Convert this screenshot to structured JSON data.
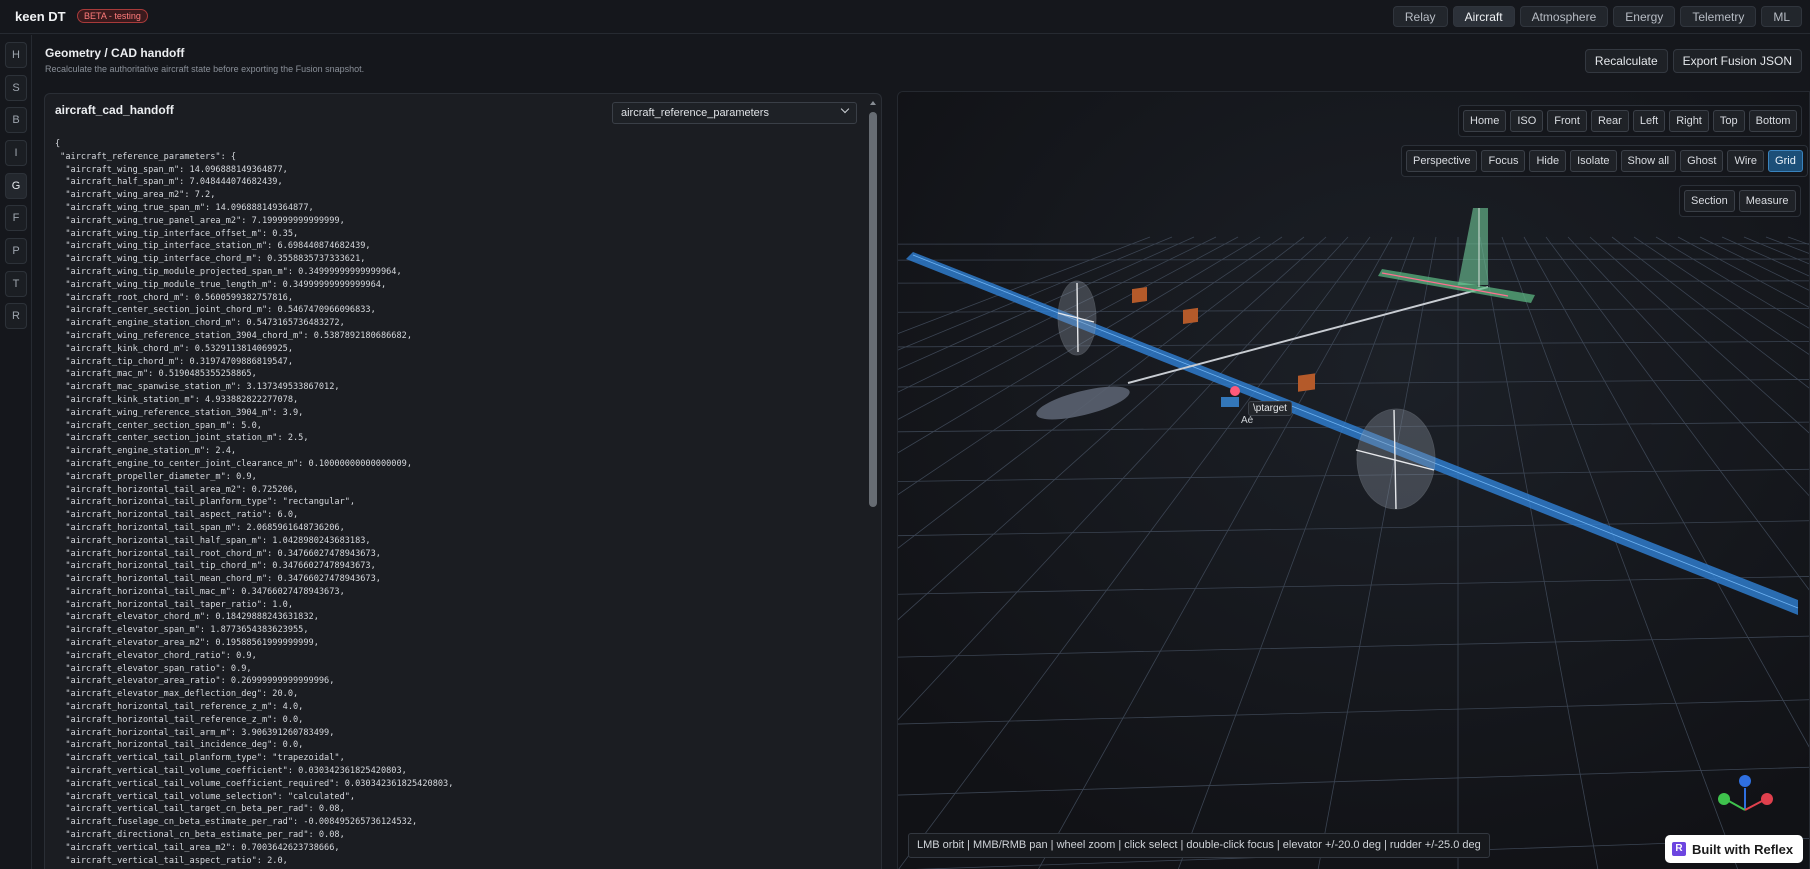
{
  "app": {
    "title": "keen DT",
    "badge": "BETA - testing"
  },
  "nav": [
    {
      "label": "Relay",
      "active": false
    },
    {
      "label": "Aircraft",
      "active": true
    },
    {
      "label": "Atmosphere",
      "active": false
    },
    {
      "label": "Energy",
      "active": false
    },
    {
      "label": "Telemetry",
      "active": false
    },
    {
      "label": "ML",
      "active": false
    }
  ],
  "rail": [
    "H",
    "S",
    "B",
    "I",
    "G",
    "F",
    "P",
    "T",
    "R"
  ],
  "rail_active": "G",
  "header": {
    "title": "Geometry / CAD handoff",
    "subtitle": "Recalculate the authoritative aircraft state before exporting the Fusion snapshot.",
    "recalculate_label": "Recalculate",
    "export_label": "Export Fusion JSON"
  },
  "json_panel": {
    "title": "aircraft_cad_handoff",
    "select_value": "aircraft_reference_parameters",
    "lines": [
      "{",
      " \"aircraft_reference_parameters\": {",
      "  \"aircraft_wing_span_m\": 14.096888149364877,",
      "  \"aircraft_half_span_m\": 7.048444074682439,",
      "  \"aircraft_wing_area_m2\": 7.2,",
      "  \"aircraft_wing_true_span_m\": 14.096888149364877,",
      "  \"aircraft_wing_true_panel_area_m2\": 7.199999999999999,",
      "  \"aircraft_wing_tip_interface_offset_m\": 0.35,",
      "  \"aircraft_wing_tip_interface_station_m\": 6.698440874682439,",
      "  \"aircraft_wing_tip_interface_chord_m\": 0.3558835737333621,",
      "  \"aircraft_wing_tip_module_projected_span_m\": 0.34999999999999964,",
      "  \"aircraft_wing_tip_module_true_length_m\": 0.34999999999999964,",
      "  \"aircraft_root_chord_m\": 0.5600599382757816,",
      "  \"aircraft_center_section_joint_chord_m\": 0.5467470966096833,",
      "  \"aircraft_engine_station_chord_m\": 0.5473165736483272,",
      "  \"aircraft_wing_reference_station_3904_chord_m\": 0.5387892180686682,",
      "  \"aircraft_kink_chord_m\": 0.5329113814069925,",
      "  \"aircraft_tip_chord_m\": 0.31974709886819547,",
      "  \"aircraft_mac_m\": 0.5190485355258865,",
      "  \"aircraft_mac_spanwise_station_m\": 3.137349533867012,",
      "  \"aircraft_kink_station_m\": 4.933882822277078,",
      "  \"aircraft_wing_reference_station_3904_m\": 3.9,",
      "  \"aircraft_center_section_span_m\": 5.0,",
      "  \"aircraft_center_section_joint_station_m\": 2.5,",
      "  \"aircraft_engine_station_m\": 2.4,",
      "  \"aircraft_engine_to_center_joint_clearance_m\": 0.10000000000000009,",
      "  \"aircraft_propeller_diameter_m\": 0.9,",
      "  \"aircraft_horizontal_tail_area_m2\": 0.725206,",
      "  \"aircraft_horizontal_tail_planform_type\": \"rectangular\",",
      "  \"aircraft_horizontal_tail_aspect_ratio\": 6.0,",
      "  \"aircraft_horizontal_tail_span_m\": 2.0685961648736206,",
      "  \"aircraft_horizontal_tail_half_span_m\": 1.0428980243683183,",
      "  \"aircraft_horizontal_tail_root_chord_m\": 0.34766027478943673,",
      "  \"aircraft_horizontal_tail_tip_chord_m\": 0.34766027478943673,",
      "  \"aircraft_horizontal_tail_mean_chord_m\": 0.34766027478943673,",
      "  \"aircraft_horizontal_tail_mac_m\": 0.34766027478943673,",
      "  \"aircraft_horizontal_tail_taper_ratio\": 1.0,",
      "  \"aircraft_elevator_chord_m\": 0.18429888243631832,",
      "  \"aircraft_elevator_span_m\": 1.8773654383623955,",
      "  \"aircraft_elevator_area_m2\": 0.19588561999999999,",
      "  \"aircraft_elevator_chord_ratio\": 0.9,",
      "  \"aircraft_elevator_span_ratio\": 0.9,",
      "  \"aircraft_elevator_area_ratio\": 0.26999999999999996,",
      "  \"aircraft_elevator_max_deflection_deg\": 20.0,",
      "  \"aircraft_horizontal_tail_reference_z_m\": 4.0,",
      "  \"aircraft_horizontal_tail_reference_z_m\": 0.0,",
      "  \"aircraft_horizontal_tail_arm_m\": 3.906391260783499,",
      "  \"aircraft_horizontal_tail_incidence_deg\": 0.0,",
      "  \"aircraft_vertical_tail_planform_type\": \"trapezoidal\",",
      "  \"aircraft_vertical_tail_volume_coefficient\": 0.030342361825420803,",
      "  \"aircraft_vertical_tail_volume_coefficient_required\": 0.030342361825420803,",
      "  \"aircraft_vertical_tail_volume_selection\": \"calculated\",",
      "  \"aircraft_vertical_tail_target_cn_beta_per_rad\": 0.08,",
      "  \"aircraft_fuselage_cn_beta_estimate_per_rad\": -0.008495265736124532,",
      "  \"aircraft_directional_cn_beta_estimate_per_rad\": 0.08,",
      "  \"aircraft_vertical_tail_area_m2\": 0.7003642623738666,",
      "  \"aircraft_vertical_tail_aspect_ratio\": 2.0,"
    ]
  },
  "viewport": {
    "view_buttons": [
      "Home",
      "ISO",
      "Front",
      "Rear",
      "Left",
      "Right",
      "Top",
      "Bottom"
    ],
    "mode_buttons": [
      {
        "label": "Perspective",
        "on": false
      },
      {
        "label": "Focus",
        "on": false
      },
      {
        "label": "Hide",
        "on": false
      },
      {
        "label": "Isolate",
        "on": false
      },
      {
        "label": "Show all",
        "on": false
      },
      {
        "label": "Ghost",
        "on": false
      },
      {
        "label": "Wire",
        "on": false
      },
      {
        "label": "Grid",
        "on": true
      }
    ],
    "tool_buttons": [
      "Section",
      "Measure"
    ],
    "tooltip": "\\ptarget",
    "axis_label": "Aé",
    "hint": "LMB orbit | MMB/RMB pan | wheel zoom | click select | double-click focus | elevator +/-20.0 deg | rudder +/-25.0 deg",
    "colors": {
      "wing": "#3a8ee0",
      "tail": "#5fbf87",
      "pod": "#b45a2a",
      "grid": "#3b4452",
      "accent": "#3a83bd"
    }
  },
  "footer": {
    "reflex_label": "Built with Reflex"
  }
}
